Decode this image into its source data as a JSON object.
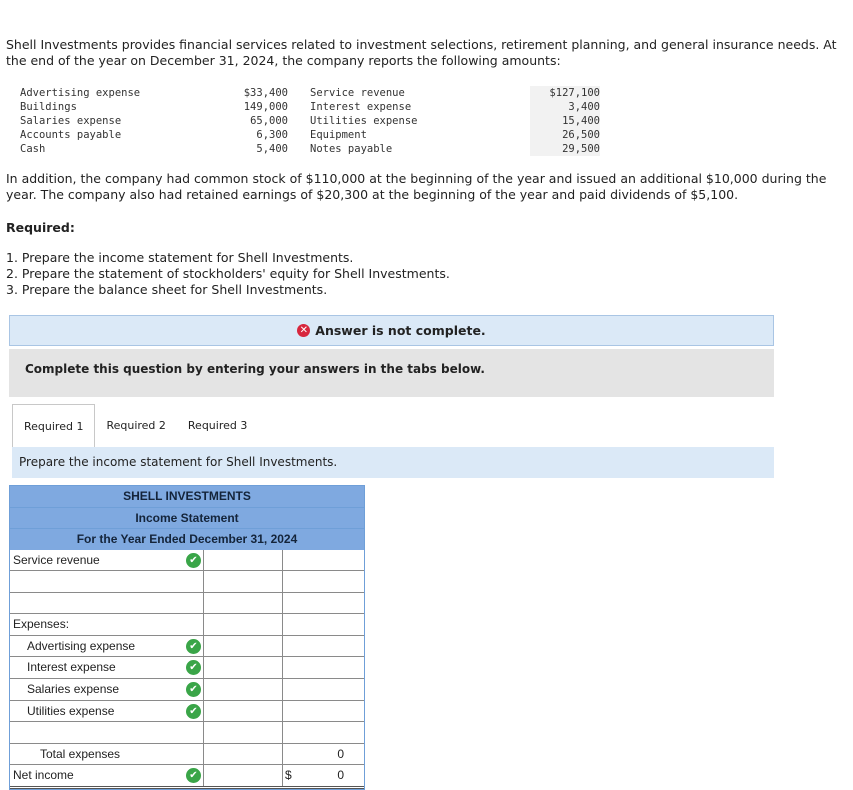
{
  "intro": "Shell Investments provides financial services related to investment selections, retirement planning, and general insurance needs. At the end of the year on December 31, 2024, the company reports the following amounts:",
  "accounts": [
    {
      "left_name": "Advertising expense",
      "left_value": "$33,400",
      "right_name": "Service revenue",
      "right_value": "$127,100"
    },
    {
      "left_name": "Buildings",
      "left_value": "149,000",
      "right_name": "Interest expense",
      "right_value": "3,400"
    },
    {
      "left_name": "Salaries expense",
      "left_value": "65,000",
      "right_name": "Utilities expense",
      "right_value": "15,400"
    },
    {
      "left_name": "Accounts payable",
      "left_value": "6,300",
      "right_name": "Equipment",
      "right_value": "26,500"
    },
    {
      "left_name": "Cash",
      "left_value": "5,400",
      "right_name": "Notes payable",
      "right_value": "29,500"
    }
  ],
  "addition": "In addition, the company had common stock of $110,000 at the beginning of the year and issued an additional $10,000 during the year. The company also had retained earnings of $20,300 at the beginning of the year and paid dividends of $5,100.",
  "required_heading": "Required:",
  "required_items": [
    "1. Prepare the income statement for Shell Investments.",
    "2. Prepare the statement of stockholders' equity for Shell Investments.",
    "3. Prepare the balance sheet for Shell Investments."
  ],
  "banner": "Answer is not complete.",
  "instructions": "Complete this question by entering your answers in the tabs below.",
  "tabs": [
    "Required 1",
    "Required 2",
    "Required 3"
  ],
  "active_tab": 0,
  "panel_prompt": "Prepare the income statement for Shell Investments.",
  "statement": {
    "company": "SHELL INVESTMENTS",
    "title": "Income Statement",
    "period": "For the Year Ended December 31, 2024",
    "rows": {
      "service_revenue": "Service revenue",
      "expenses": "Expenses:",
      "advertising": "Advertising expense",
      "interest": "Interest expense",
      "salaries": "Salaries expense",
      "utilities": "Utilities expense",
      "total_expenses": "Total expenses",
      "total_expenses_value": "0",
      "net_income": "Net income",
      "net_income_currency": "$",
      "net_income_value": "0"
    }
  },
  "colors": {
    "correct": "#3aa548",
    "incorrect": "#d7263d",
    "header_blue": "#7fa9e0",
    "panel_blue": "#dbe9f7"
  }
}
